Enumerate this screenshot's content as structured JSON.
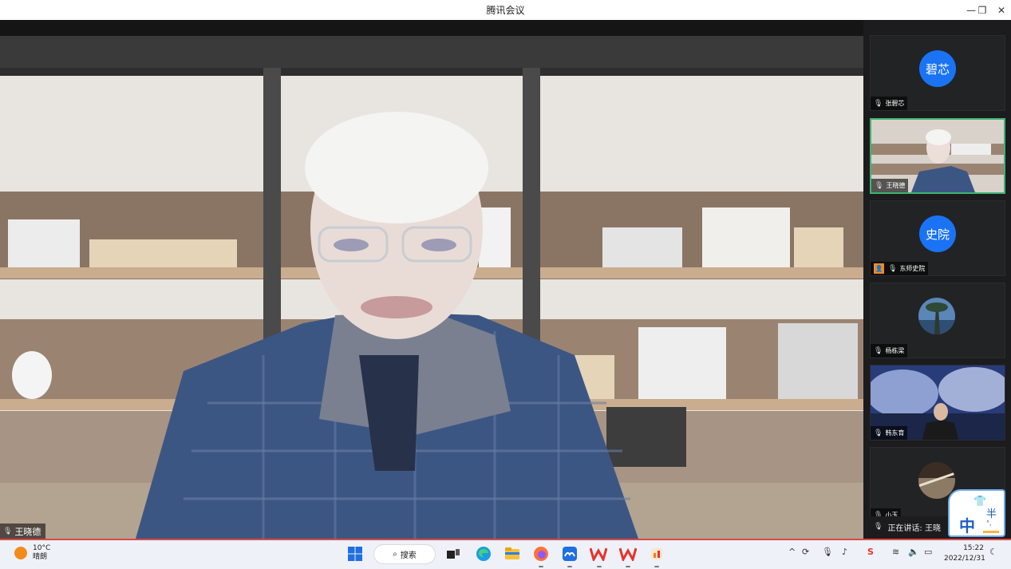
{
  "window": {
    "title": "腾讯会议",
    "minimize": "—",
    "restore": "❐",
    "close": "✕"
  },
  "main_video": {
    "speaker_name": "王晓德"
  },
  "participants": [
    {
      "avatar_text": "碧芯",
      "name": "张碧芯",
      "type": "avatar"
    },
    {
      "name": "王晓德",
      "type": "video",
      "active": true
    },
    {
      "avatar_text": "史院",
      "name": "东师史院",
      "type": "avatar",
      "host": true
    },
    {
      "name": "杨栋梁",
      "type": "photo"
    },
    {
      "name": "韩东育",
      "type": "video"
    },
    {
      "name": "小玉",
      "type": "photo"
    }
  ],
  "speaking_indicator": {
    "text": "正在讲话: 王晓"
  },
  "ime": {
    "mode": "中",
    "width": "半",
    "sub": "°,",
    "shirt": "👕"
  },
  "taskbar": {
    "weather": {
      "temp": "10°C",
      "condition": "晴朗"
    },
    "search_label": "搜索",
    "clock": {
      "time": "15:22",
      "date": "2022/12/31"
    }
  }
}
